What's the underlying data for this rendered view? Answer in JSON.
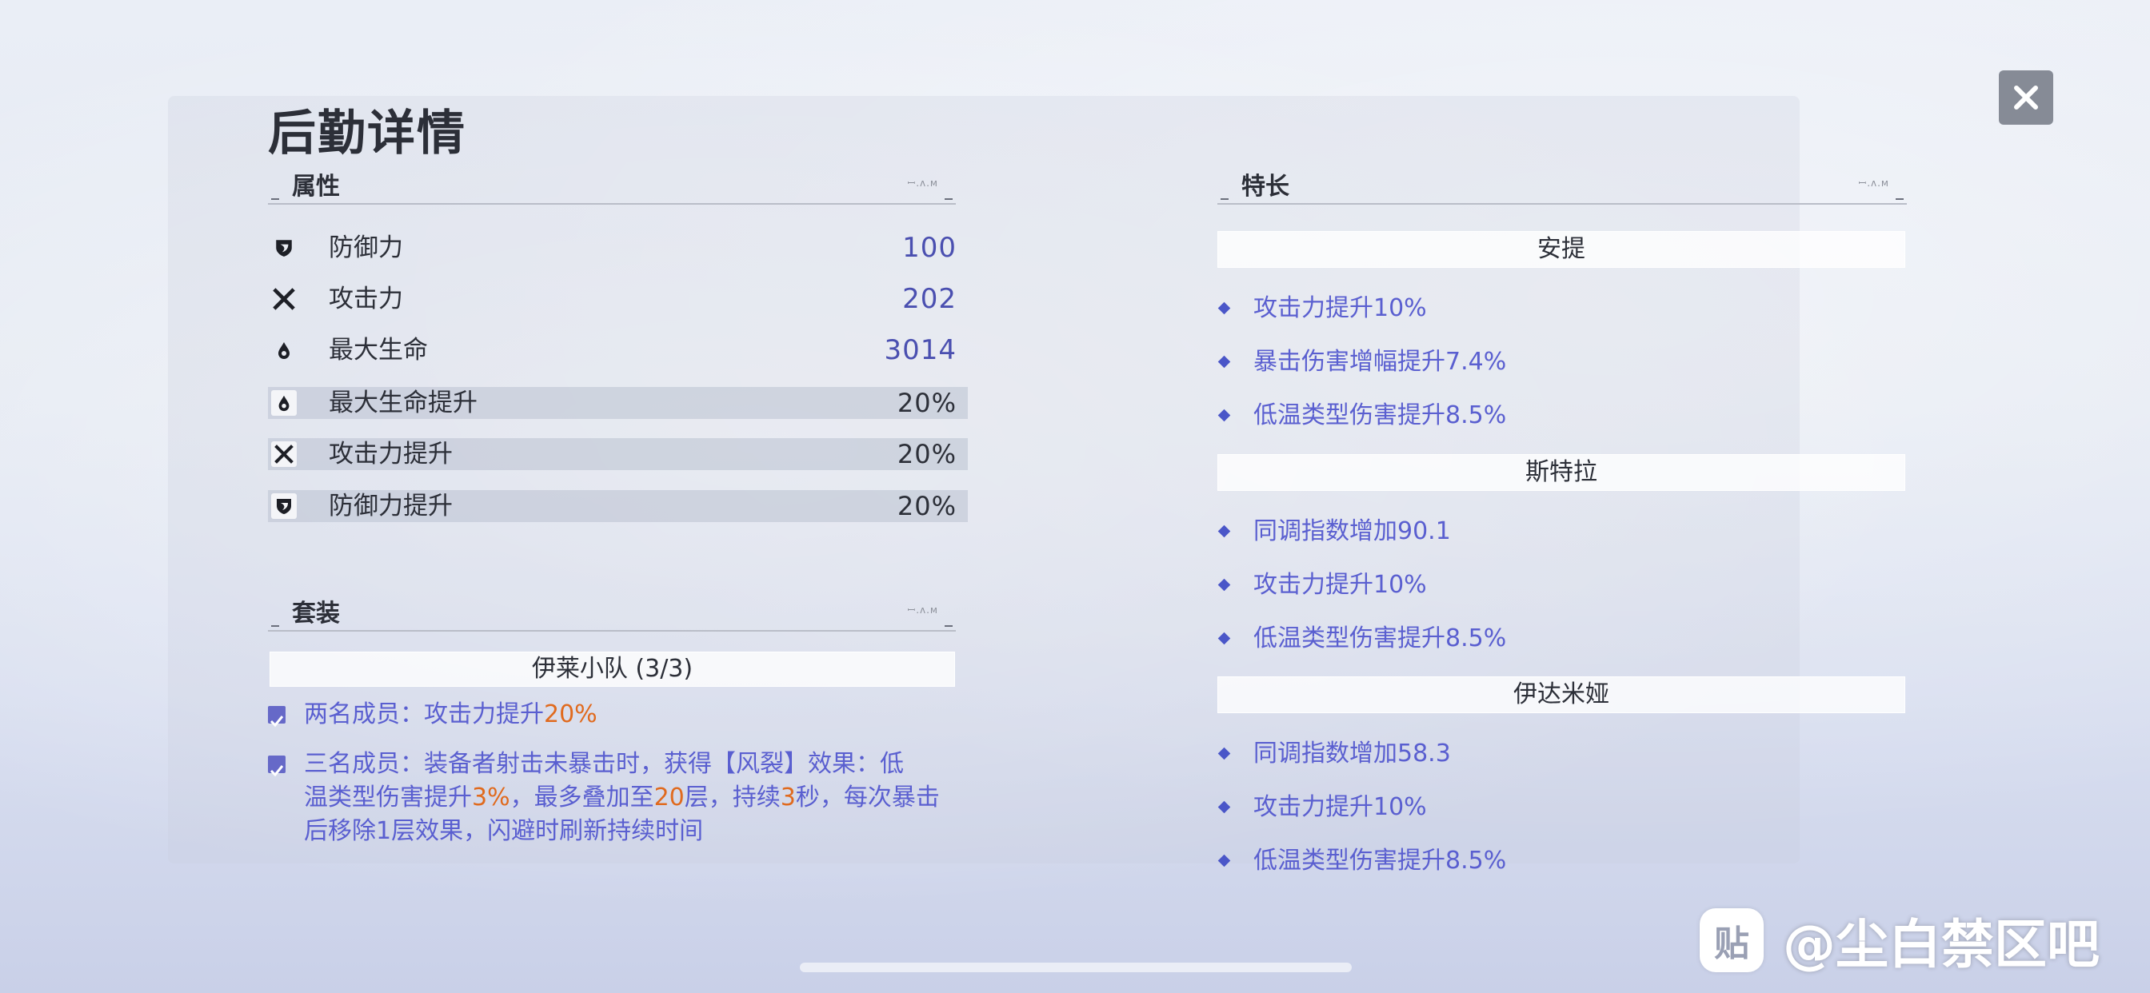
{
  "title": "后勤详情",
  "close_icon": "close-icon",
  "attributes": {
    "heading": "属性",
    "stats": [
      {
        "icon": "shield-icon",
        "name": "防御力",
        "value": "100"
      },
      {
        "icon": "crossed-swords-icon",
        "name": "攻击力",
        "value": "202"
      },
      {
        "icon": "droplet-icon",
        "name": "最大生命",
        "value": "3014"
      },
      {
        "icon": "droplet-icon",
        "name": "最大生命提升",
        "value": "20%"
      },
      {
        "icon": "crossed-swords-icon",
        "name": "攻击力提升",
        "value": "20%"
      },
      {
        "icon": "shield-icon",
        "name": "防御力提升",
        "value": "20%"
      }
    ]
  },
  "set": {
    "heading": "套装",
    "name": "伊莱小队 (3/3)",
    "effects": [
      {
        "prefix": "两名成员：攻击力提升",
        "highlight": "20%"
      },
      {
        "line1": "三名成员：装备者射击未暴击时，获得【风裂】效果：低",
        "line2_a": "温类型伤害提升",
        "line2_b": "3%",
        "line2_c": "，最多叠加至",
        "line2_d": "20",
        "line2_e": "层，持续",
        "line2_f": "3",
        "line2_g": "秒，每次暴击",
        "line3": "后移除1层效果，闪避时刷新持续时间"
      }
    ]
  },
  "specialties": {
    "heading": "特长",
    "groups": [
      {
        "name": "安提",
        "perks": [
          "攻击力提升10%",
          "暴击伤害增幅提升7.4%",
          "低温类型伤害提升8.5%"
        ]
      },
      {
        "name": "斯特拉",
        "perks": [
          "同调指数增加90.1",
          "攻击力提升10%",
          "低温类型伤害提升8.5%"
        ]
      },
      {
        "name": "伊达米娅",
        "perks": [
          "同调指数增加58.3",
          "攻击力提升10%",
          "低温类型伤害提升8.5%"
        ]
      }
    ]
  },
  "watermark": {
    "logo": "贴",
    "text": "@尘白禁区吧"
  },
  "colors": {
    "accent": "#5a5fd0",
    "highlight": "#e06a1e",
    "value": "#4a4fb0"
  }
}
